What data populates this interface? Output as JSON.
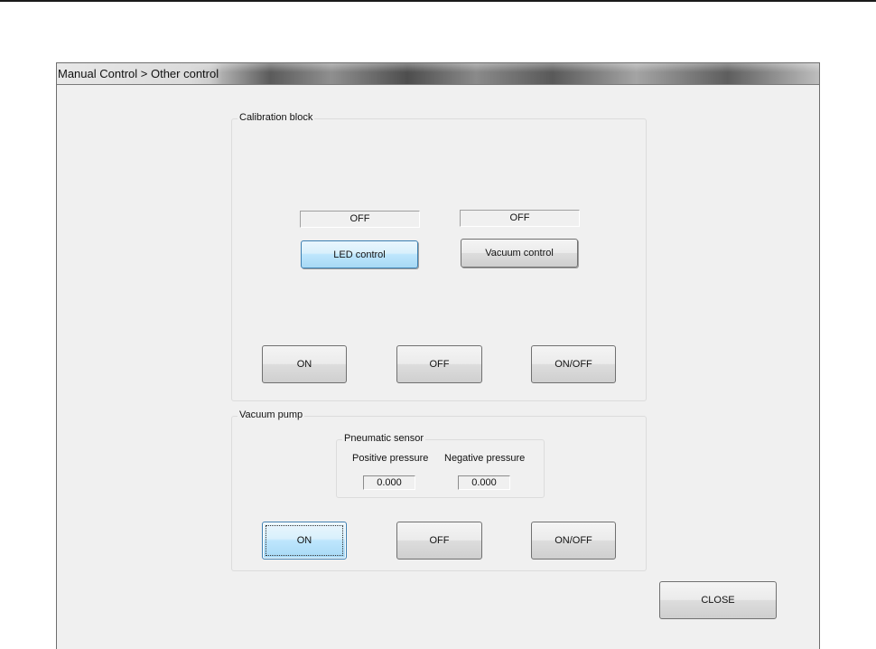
{
  "window": {
    "title": "Manual Control > Other control"
  },
  "calibration_block": {
    "label": "Calibration block",
    "led_status": "OFF",
    "vacuum_status": "OFF",
    "led_button": "LED control",
    "vacuum_button": "Vacuum control",
    "on_button": "ON",
    "off_button": "OFF",
    "onoff_button": "ON/OFF"
  },
  "vacuum_pump": {
    "label": "Vacuum pump",
    "pneumatic_sensor": {
      "label": "Pneumatic sensor",
      "positive_label": "Positive pressure",
      "negative_label": "Negative pressure",
      "positive_value": "0.000",
      "negative_value": "0.000"
    },
    "on_button": "ON",
    "off_button": "OFF",
    "onoff_button": "ON/OFF"
  },
  "footer": {
    "close_button": "CLOSE"
  },
  "colors": {
    "selected_button": "#bee6fd",
    "window_background": "#f0f0f0"
  }
}
